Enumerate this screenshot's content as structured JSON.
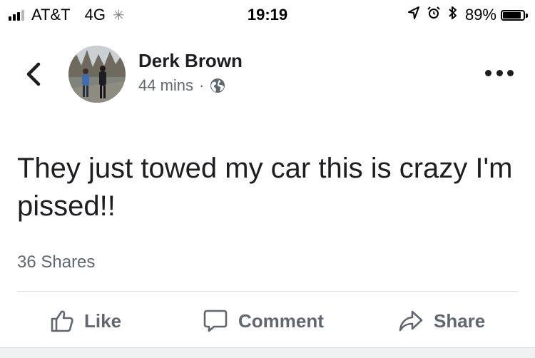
{
  "status_bar": {
    "carrier": "AT&T",
    "network": "4G",
    "time": "19:19",
    "battery_percent": "89%",
    "battery_level": 0.89,
    "signal_bars_filled": 3,
    "signal_bars_total": 4,
    "icons": [
      "signal-icon",
      "activity-spinner-icon",
      "location-arrow-icon",
      "alarm-icon",
      "bluetooth-icon",
      "battery-icon"
    ]
  },
  "post": {
    "author_name": "Derk Brown",
    "timestamp": "44 mins",
    "separator": "·",
    "privacy_icon": "globe-icon",
    "text": "They just towed my car this is crazy I'm pissed!!",
    "shares": "36 Shares"
  },
  "actions": {
    "like_label": "Like",
    "comment_label": "Comment",
    "share_label": "Share"
  },
  "colors": {
    "text_primary": "#1c1e21",
    "text_secondary": "#606770",
    "divider": "#dddfe2"
  }
}
